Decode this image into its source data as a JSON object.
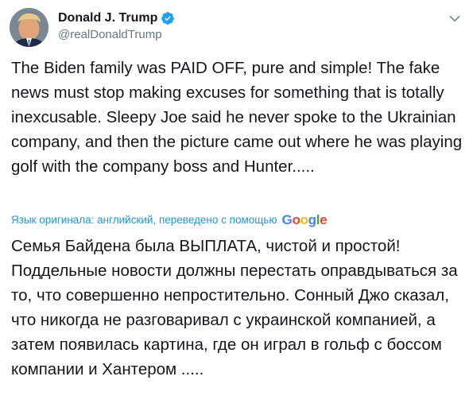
{
  "author": {
    "display_name": "Donald J. Trump",
    "handle": "@realDonaldTrump",
    "verified": true
  },
  "tweet": {
    "text": "The Biden family was PAID OFF, pure and simple! The fake news must stop making excuses for something that is totally inexcusable. Sleepy Joe said he never spoke to the Ukrainian company, and then the picture came out where he was playing golf with the company boss and Hunter.....",
    "translation_notice": "Язык оригинала: английский, переведено с помощью",
    "translation_provider": "Google",
    "translated_text": "Семья Байдена была ВЫПЛАТА, чистой и простой! Поддельные новости должны перестать оправдываться за то, что совершенно непростительно. Сонный Джо сказал, что никогда не разговаривал с украинской компанией, а затем появилась картина, где он играл в гольф с боссом компании и Хантером ....."
  },
  "icons": {
    "verified": "verified-badge-icon",
    "menu": "chevron-down-icon"
  },
  "colors": {
    "text": "#14171a",
    "secondary": "#657786",
    "link": "#1b95e0",
    "verified": "#1da1f2",
    "google_blue": "#4285f4",
    "google_red": "#ea4335",
    "google_yellow": "#fbbc05",
    "google_green": "#34a853"
  }
}
